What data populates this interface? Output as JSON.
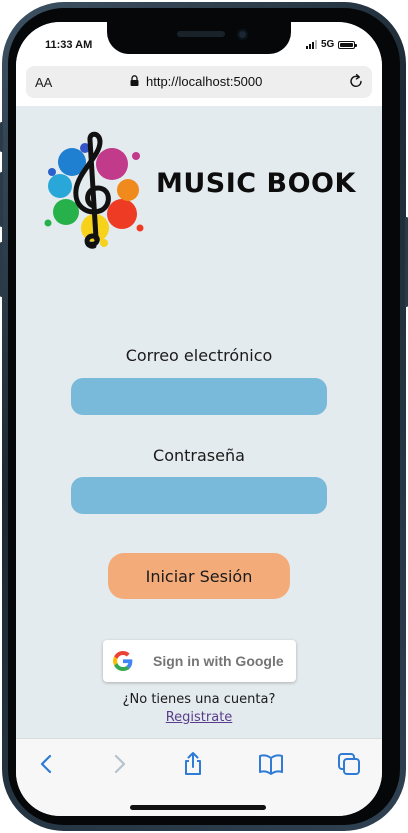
{
  "status_bar": {
    "time": "11:33 AM",
    "network": "5G"
  },
  "browser": {
    "text_size_label": "AA",
    "url": "http://localhost:5000",
    "icons": {
      "lock": "lock-icon",
      "reload": "reload-icon"
    },
    "toolbar": [
      "back-icon",
      "forward-icon",
      "share-icon",
      "bookmarks-icon",
      "tabs-icon"
    ]
  },
  "app": {
    "brand": "MUSIC BOOK",
    "logo": "treble-clef-paint-splash-logo"
  },
  "form": {
    "email_label": "Correo electrónico",
    "email_value": "",
    "password_label": "Contraseña",
    "password_value": "",
    "login_button": "Iniciar Sesión",
    "google_button": "Sign in with Google",
    "no_account_text": "¿No tienes una cuenta?",
    "register_link": "Registrate"
  },
  "colors": {
    "page_background": "#e4ebee",
    "input_background": "#79b9d9",
    "login_button": "#f3ac79",
    "register_link": "#5a3d8a",
    "toolbar_icons": "#2f7bd6"
  }
}
